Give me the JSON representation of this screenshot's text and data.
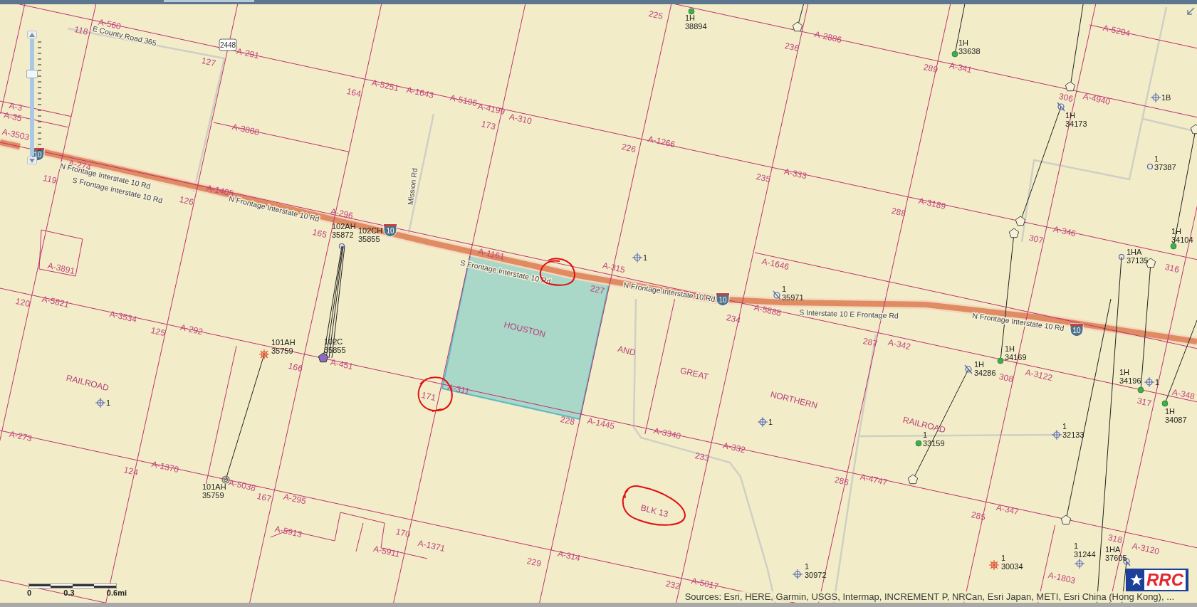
{
  "zoom_slider": {
    "level": 0.72
  },
  "map": {
    "parcel_labels": [
      "A-560",
      "118",
      "A-291",
      "127",
      "A-5251",
      "164",
      "A-1643",
      "A-5196",
      "A-4199",
      "A-310",
      "173",
      "A-1266",
      "226",
      "A-333",
      "235",
      "A-3189",
      "288",
      "A-346",
      "307",
      "316",
      "A-2886",
      "236",
      "225",
      "289",
      "A-341",
      "A-5204",
      "306",
      "A-4940",
      "A-3808",
      "A-3",
      "A-35",
      "A-3503",
      "A-274",
      "119",
      "126",
      "A-1405",
      "A-296",
      "165",
      "A-3891",
      "A-1161",
      "227",
      "A-315",
      "A-1646",
      "A-5888",
      "234",
      "287",
      "A-342",
      "308",
      "A-3122",
      "317",
      "A-348",
      "120",
      "A-5821",
      "A-3534",
      "125",
      "A-292",
      "A-451",
      "166",
      "171",
      "A-311",
      "228",
      "A-1445",
      "A-3340",
      "A-332",
      "233",
      "286",
      "A-4747",
      "285",
      "A-347",
      "318",
      "A-3120",
      "A-1803",
      "A-273",
      "124",
      "A-1370",
      "A-5038",
      "167",
      "A-295",
      "A-5913",
      "170",
      "A-5911",
      "A-1371",
      "229",
      "A-314",
      "232",
      "A-5017"
    ],
    "survey_labels": [
      "HOUSTON",
      "AND",
      "GREAT",
      "NORTHERN",
      "RAILROAD",
      "RAILROAD",
      "BLK 13"
    ],
    "road_labels": [
      "E County Road 365",
      "N Frontage Interstate 10 Rd",
      "S Frontage Interstate 10 Rd",
      "N Frontage Interstate 10 Rd",
      "S Frontage Interstate 10 Rd",
      "N Frontage Interstate 10 Rd",
      "S Interstate 10 E Frontage Rd",
      "N Frontage Interstate 10 Rd",
      "Mission Rd"
    ],
    "shields": [
      {
        "kind": "state",
        "label": "2448"
      },
      {
        "kind": "interstate",
        "label": "10"
      },
      {
        "kind": "interstate",
        "label": "10"
      },
      {
        "kind": "interstate",
        "label": "10"
      },
      {
        "kind": "interstate",
        "label": "10"
      }
    ],
    "wells": [
      {
        "kind": "oil",
        "name": "1H",
        "number": "38894"
      },
      {
        "kind": "oil",
        "name": "1H",
        "number": "33638"
      },
      {
        "kind": "permit",
        "name": "1H",
        "number": "34173"
      },
      {
        "kind": "location",
        "name": "1B"
      },
      {
        "kind": "surface",
        "name": "1",
        "number": "37387"
      },
      {
        "kind": "oil",
        "name": "1H",
        "number": "34104"
      },
      {
        "kind": "surface",
        "name": "1HA",
        "number": "37135"
      },
      {
        "kind": "location",
        "name": "1"
      },
      {
        "kind": "permit",
        "name": "1",
        "number": "35971"
      },
      {
        "kind": "location",
        "name": "1"
      },
      {
        "kind": "oil",
        "name": "1H",
        "number": "34169"
      },
      {
        "kind": "permit",
        "name": "1H",
        "number": "34286"
      },
      {
        "kind": "oil",
        "name": "1H",
        "number": "34196"
      },
      {
        "kind": "location",
        "name": "1"
      },
      {
        "kind": "oil",
        "name": "1H",
        "number": "34087"
      },
      {
        "kind": "oil",
        "name": "1",
        "number": "33159"
      },
      {
        "kind": "location",
        "name": "1",
        "number": "32133"
      },
      {
        "kind": "location",
        "name": "1",
        "number": "31244"
      },
      {
        "kind": "permit",
        "name": "1HA",
        "number": "37605"
      },
      {
        "kind": "dry",
        "name": "1",
        "number": "30034"
      },
      {
        "kind": "location",
        "name": "1",
        "number": "30972"
      },
      {
        "kind": "location",
        "name": "1"
      },
      {
        "kind": "dry",
        "name": "101AH",
        "number": "35759"
      },
      {
        "kind": "plugged",
        "name": "101AH",
        "number": "35759"
      },
      {
        "kind": "horizontal",
        "name": "102C",
        "number": "35855"
      },
      {
        "kind": "surface",
        "name": "102AH",
        "number": "35872"
      },
      {
        "kind": "label",
        "name": "102CH",
        "number": "35855"
      }
    ]
  },
  "scale_bar": {
    "ticks": [
      "0",
      "0.3",
      "0.6mi"
    ]
  },
  "attribution": "Sources: Esri, HERE, Garmin, USGS, Intermap, INCREMENT P, NRCan, Esri Japan, METI, Esri China (Hong Kong), ...",
  "logo": "RRC"
}
